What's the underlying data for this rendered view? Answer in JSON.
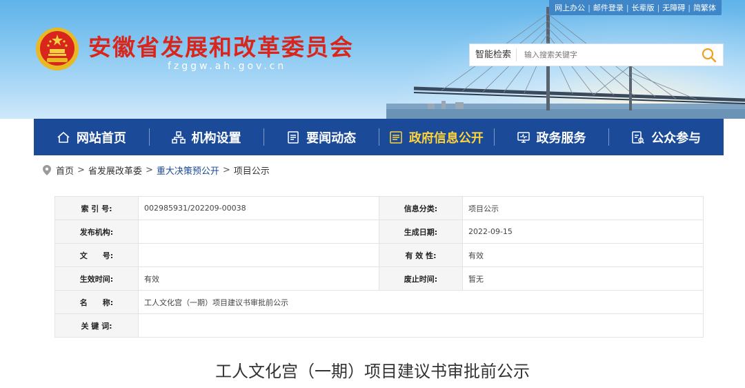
{
  "top_links": [
    "网上办公",
    "邮件登录",
    "长辈版",
    "无障碍",
    "简繁体"
  ],
  "site": {
    "title": "安徽省发展和改革委员会",
    "domain": "fzggw.ah.gov.cn"
  },
  "search": {
    "label": "智能检索",
    "placeholder": "输入搜索关键字"
  },
  "nav": [
    {
      "label": "网站首页",
      "icon": "home-icon"
    },
    {
      "label": "机构设置",
      "icon": "org-chart-icon"
    },
    {
      "label": "要闻动态",
      "icon": "news-icon"
    },
    {
      "label": "政府信息公开",
      "icon": "info-disclosure-icon",
      "active": true
    },
    {
      "label": "政务服务",
      "icon": "service-monitor-icon"
    },
    {
      "label": "公众参与",
      "icon": "participation-icon"
    }
  ],
  "breadcrumb": [
    "首页",
    "省发展改革委",
    "重大决策预公开",
    "项目公示"
  ],
  "meta": {
    "index_label": "索 引 号:",
    "index_value": "002985931/202209-00038",
    "category_label": "信息分类:",
    "category_value": "项目公示",
    "publisher_label": "发布机构:",
    "publisher_value": "",
    "date_label": "生成日期:",
    "date_value": "2022-09-15",
    "docno_label": "文　　号:",
    "docno_value": "",
    "validity_label": "有 效 性:",
    "validity_value": "有效",
    "effective_label": "生效时间:",
    "effective_value": "有效",
    "expiry_label": "废止时间:",
    "expiry_value": "暂无",
    "name_label": "名　　称:",
    "name_value": "工人文化宫（一期）项目建议书审批前公示",
    "keywords_label": "关 键 词:",
    "keywords_value": ""
  },
  "article": {
    "title": "工人文化宫（一期）项目建议书审批前公示"
  },
  "colors": {
    "nav_bg": "#1a4a98",
    "nav_active": "#ffd43b",
    "title_red": "#d9261c",
    "header_sky": "#5fb3ea"
  }
}
